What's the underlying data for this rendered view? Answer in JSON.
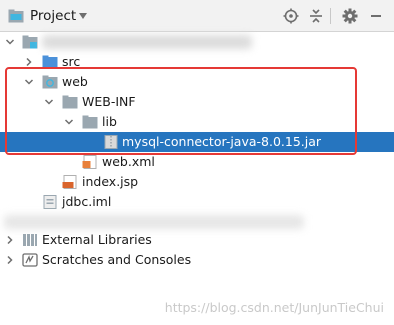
{
  "header": {
    "title": "Project",
    "icons": [
      "project-icon",
      "dropdown-caret-icon",
      "locate-crosshair-icon",
      "collapse-all-icon",
      "gear-icon",
      "minimize-icon"
    ]
  },
  "tree": {
    "src": "src",
    "web": "web",
    "web_inf": "WEB-INF",
    "lib": "lib",
    "jar": "mysql-connector-java-8.0.15.jar",
    "web_xml": "web.xml",
    "index_jsp": "index.jsp",
    "jdbc_iml": "jdbc.iml",
    "external_libraries": "External Libraries",
    "scratches": "Scratches and Consoles"
  },
  "watermark": "https://blog.csdn.net/JunJunTieChui",
  "colors": {
    "selection": "#2675bf",
    "highlight_box": "#e53935",
    "folder": "#9aa7b0",
    "source_folder": "#4a90d9",
    "header_bg": "#f2f2f2"
  }
}
